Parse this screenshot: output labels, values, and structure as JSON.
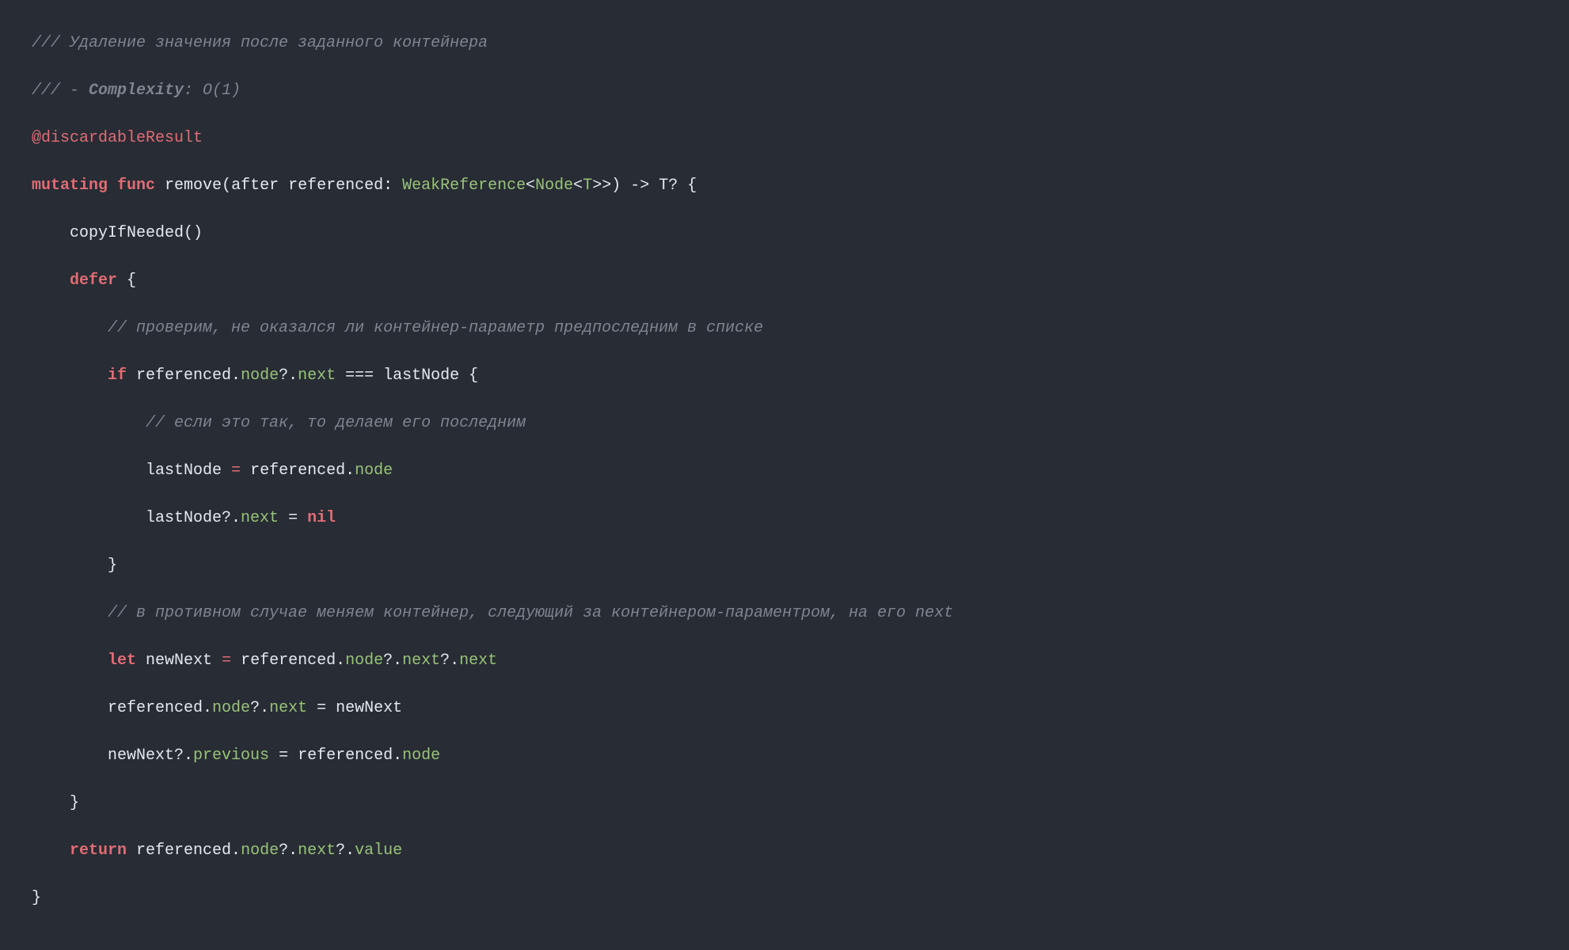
{
  "code": {
    "l1_comment": "/// Удаление значения после заданного контейнера",
    "l2_prefix": "/// - ",
    "l2_complexity": "Complexity",
    "l2_suffix": ": O(1)",
    "l3_attr": "@discardableResult",
    "l4_mutating": "mutating",
    "l4_func": "func",
    "l4_name": " remove(after referenced: ",
    "l4_type1": "WeakReference",
    "l4_lt1": "<",
    "l4_type2": "Node",
    "l4_lt2": "<",
    "l4_type3": "T",
    "l4_gt": ">>",
    "l4_end": ") -> T? {",
    "l5": "    copyIfNeeded()",
    "l6_indent": "    ",
    "l6_defer": "defer",
    "l6_brace": " {",
    "l7_comment": "        // проверим, не оказался ли контейнер-параметр предпоследним в списке",
    "l8_indent": "        ",
    "l8_if": "if",
    "l8_a": " referenced.",
    "l8_node": "node",
    "l8_q": "?.",
    "l8_next": "next",
    "l8_op": " === ",
    "l8_last": "lastNode {",
    "l9_comment": "            // если это так, то делаем его последним",
    "l10_a": "            lastNode ",
    "l10_eq": "=",
    "l10_b": " referenced.",
    "l10_node": "node",
    "l11_a": "            lastNode?.",
    "l11_next": "next",
    "l11_eq": " = ",
    "l11_nil": "nil",
    "l12": "        }",
    "l13_comment": "        // в противном случае меняем контейнер, следующий за контейнером-параментром, на его next",
    "l14_indent": "        ",
    "l14_let": "let",
    "l14_a": " newNext ",
    "l14_eq": "=",
    "l14_b": " referenced.",
    "l14_node": "node",
    "l14_q1": "?.",
    "l14_next1": "next",
    "l14_q2": "?.",
    "l14_next2": "next",
    "l15_a": "        referenced.",
    "l15_node": "node",
    "l15_q": "?.",
    "l15_next": "next",
    "l15_eq": " = ",
    "l15_new": "newNext",
    "l16_a": "        newNext?.",
    "l16_prev": "previous",
    "l16_eq": " = ",
    "l16_b": "referenced.",
    "l16_node": "node",
    "l17": "    }",
    "l18_indent": "    ",
    "l18_return": "return",
    "l18_a": " referenced.",
    "l18_node": "node",
    "l18_q1": "?.",
    "l18_next": "next",
    "l18_q2": "?.",
    "l18_value": "value",
    "l19": "}"
  }
}
